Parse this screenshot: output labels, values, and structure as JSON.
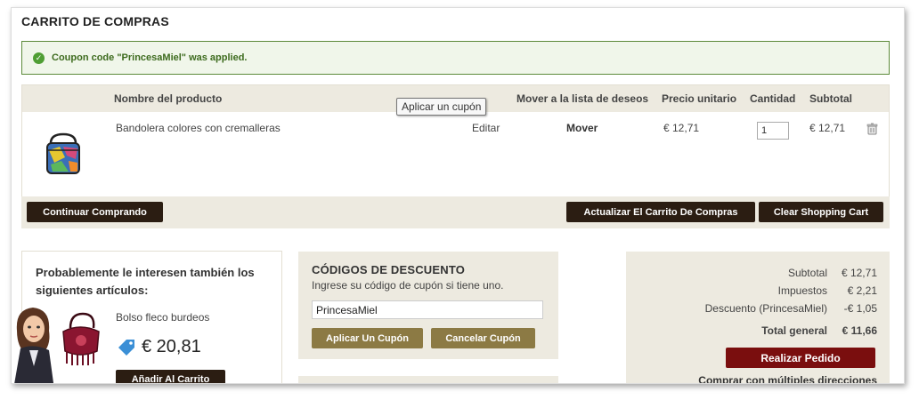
{
  "page_title": "CARRITO DE COMPRAS",
  "success_message": "Coupon code \"PrincesaMiel\" was applied.",
  "table": {
    "headers": {
      "product": "Nombre del producto",
      "wishlist": "Mover a la lista de deseos",
      "unit_price": "Precio unitario",
      "qty": "Cantidad",
      "subtotal": "Subtotal"
    },
    "items": [
      {
        "name": "Bandolera colores con cremalleras",
        "edit": "Editar",
        "move": "Mover",
        "unit_price": "€ 12,71",
        "qty": "1",
        "subtotal": "€ 12,71"
      }
    ]
  },
  "tooltip": "Aplicar un cupón",
  "buttons": {
    "continue": "Continuar Comprando",
    "update": "Actualizar El Carrito De Compras",
    "clear": "Clear Shopping Cart"
  },
  "crosssell": {
    "heading": "Probablemente le interesen también los siguientes artículos:",
    "product_name": "Bolso fleco burdeos",
    "price": "€ 20,81",
    "add_button": "Añadir Al Carrito"
  },
  "discount": {
    "heading": "CÓDIGOS DE DESCUENTO",
    "subtitle": "Ingrese su código de cupón si tiene uno.",
    "value": "PrincesaMiel",
    "apply": "Aplicar Un Cupón",
    "cancel": "Cancelar Cupón"
  },
  "totals": {
    "subtotal_label": "Subtotal",
    "subtotal_value": "€ 12,71",
    "tax_label": "Impuestos",
    "tax_value": "€ 2,21",
    "discount_label": "Descuento (PrincesaMiel)",
    "discount_value": "-€ 1,05",
    "grand_label": "Total general",
    "grand_value": "€ 11,66",
    "checkout": "Realizar Pedido",
    "multi": "Comprar con múltiples direcciones"
  },
  "colors": {
    "accent_dark": "#2b1d12",
    "olive": "#8c7a44",
    "checkout_red": "#7a0e0e",
    "success_green": "#4f9e34",
    "panel_beige": "#edeae0"
  }
}
